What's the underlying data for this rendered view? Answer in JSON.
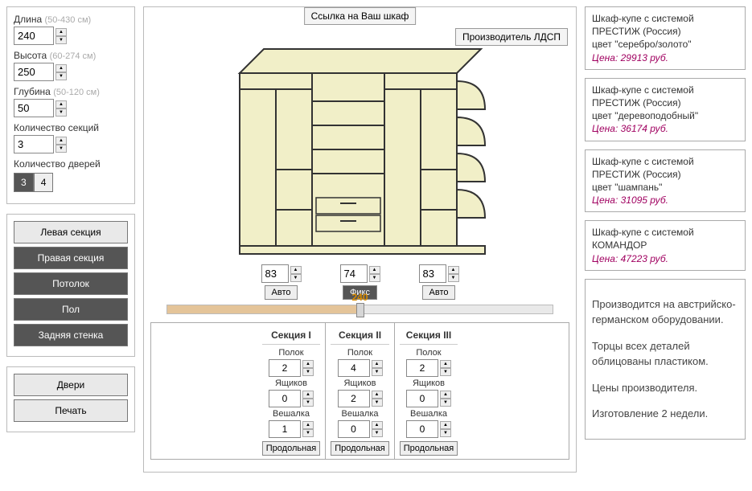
{
  "top": {
    "link_label": "Ссылка на Ваш шкаф",
    "mfr_label": "Производитель ЛДСП"
  },
  "dims": {
    "length": {
      "label": "Длина",
      "hint": "(50-430 см)",
      "value": "240"
    },
    "height": {
      "label": "Высота",
      "hint": "(60-274 см)",
      "value": "250"
    },
    "depth": {
      "label": "Глубина",
      "hint": "(50-120 см)",
      "value": "50"
    },
    "sections": {
      "label": "Количество секций",
      "value": "3"
    },
    "doors": {
      "label": "Количество дверей",
      "opt1": "3",
      "opt2": "4",
      "selected": "3"
    }
  },
  "side_buttons": {
    "left_sec": "Левая секция",
    "right_sec": "Правая секция",
    "ceiling": "Потолок",
    "floor": "Пол",
    "back": "Задняя стенка",
    "doors": "Двери",
    "print": "Печать"
  },
  "sec_widths": {
    "s1": {
      "val": "83",
      "mode": "Авто"
    },
    "s2": {
      "val": "74",
      "mode": "Фикс"
    },
    "s3": {
      "val": "83",
      "mode": "Авто"
    }
  },
  "slider": {
    "value": "240"
  },
  "sections_table": {
    "headers": [
      "Секция I",
      "Секция II",
      "Секция III"
    ],
    "labels": {
      "shelves": "Полок",
      "drawers": "Ящиков",
      "hanger": "Вешалка",
      "long": "Продольная"
    },
    "cols": [
      {
        "shelves": "2",
        "drawers": "0",
        "hanger": "1"
      },
      {
        "shelves": "4",
        "drawers": "2",
        "hanger": "0"
      },
      {
        "shelves": "2",
        "drawers": "0",
        "hanger": "0"
      }
    ]
  },
  "prices": {
    "p1": {
      "l1": "Шкаф-купе с системой",
      "l2": "ПРЕСТИЖ (Россия)",
      "l3": "цвет \"серебро/золото\"",
      "pl": "Цена: 29913 руб."
    },
    "p2": {
      "l1": "Шкаф-купе с системой",
      "l2": "ПРЕСТИЖ (Россия)",
      "l3": "цвет \"деревоподобный\"",
      "pl": "Цена: 36174 руб."
    },
    "p3": {
      "l1": "Шкаф-купе с системой",
      "l2": "ПРЕСТИЖ (Россия)",
      "l3": "цвет \"шампань\"",
      "pl": "Цена: 31095 руб."
    },
    "p4": {
      "l1": "Шкаф-купе с системой",
      "l2": "КОМАНДОР",
      "pl": "Цена: 47223 руб."
    }
  },
  "notes": {
    "n1": "Производится на австрийско-германском оборудовании.",
    "n2": "Торцы всех деталей облицованы пластиком.",
    "n3": "Цены производителя.",
    "n4": "Изготовление 2 недели."
  }
}
